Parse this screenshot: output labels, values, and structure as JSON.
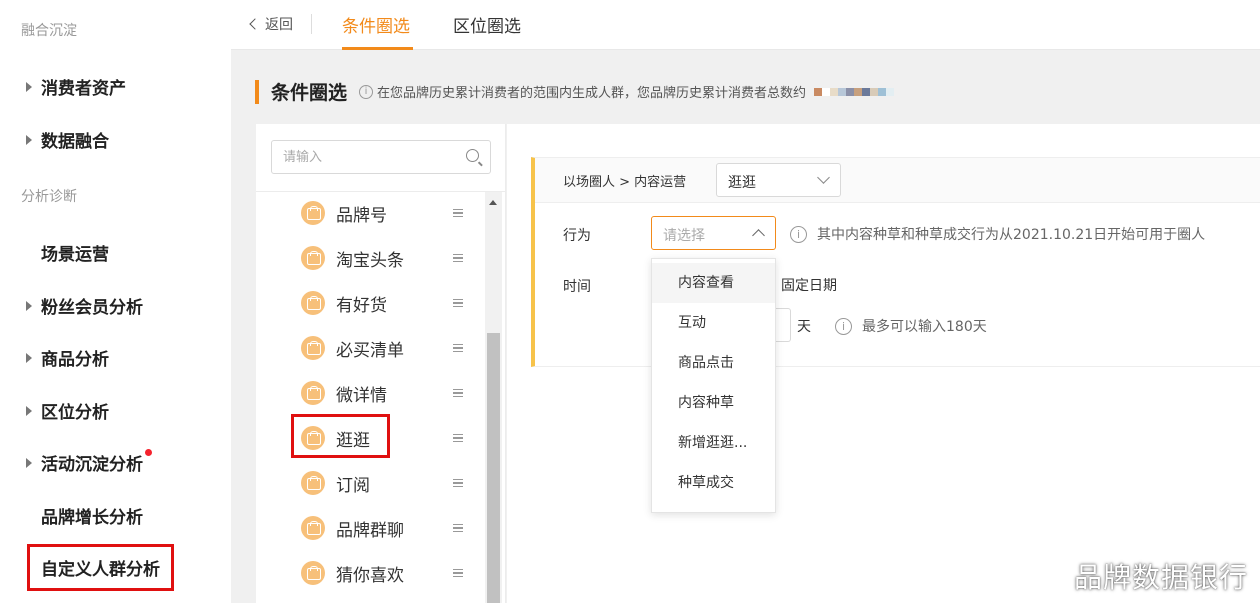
{
  "sidebar": {
    "sections": [
      "融合沉淀",
      "分析诊断"
    ],
    "items": [
      {
        "label": "消费者资产",
        "has_arrow": true
      },
      {
        "label": "数据融合",
        "has_arrow": true
      },
      {
        "label": "场景运营",
        "has_arrow": false
      },
      {
        "label": "粉丝会员分析",
        "has_arrow": true
      },
      {
        "label": "商品分析",
        "has_arrow": true
      },
      {
        "label": "区位分析",
        "has_arrow": true
      },
      {
        "label": "活动沉淀分析",
        "has_arrow": true,
        "badge": "red-dot"
      },
      {
        "label": "品牌增长分析",
        "has_arrow": false
      },
      {
        "label": "自定义人群分析",
        "has_arrow": false,
        "highlighted": true
      }
    ]
  },
  "topbar": {
    "back_label": "返回",
    "tabs": [
      {
        "label": "条件圈选",
        "active": true
      },
      {
        "label": "区位圈选",
        "active": false
      }
    ]
  },
  "header": {
    "title": "条件圈选",
    "description": "在您品牌历史累计消费者的范围内生成人群，您品牌历史累计消费者总数约"
  },
  "list": {
    "search_placeholder": "请输入",
    "items": [
      {
        "label": "品牌号",
        "icon": "shopping-bag-icon"
      },
      {
        "label": "淘宝头条",
        "icon": "shopping-bag-icon"
      },
      {
        "label": "有好货",
        "icon": "shopping-bag-icon"
      },
      {
        "label": "必买清单",
        "icon": "shopping-bag-icon"
      },
      {
        "label": "微详情",
        "icon": "shopping-bag-icon"
      },
      {
        "label": "逛逛",
        "icon": "shopping-bag-icon",
        "highlighted": true
      },
      {
        "label": "订阅",
        "icon": "shopping-bag-icon"
      },
      {
        "label": "品牌群聊",
        "icon": "shopping-bag-icon"
      },
      {
        "label": "猜你喜欢",
        "icon": "shopping-bag-icon"
      }
    ]
  },
  "form": {
    "breadcrumb": "以场圈人 > 内容运营",
    "scene_value": "逛逛",
    "behavior_label": "行为",
    "behavior_placeholder": "请选择",
    "behavior_hint": "其中内容种草和种草成交行为从2021.10.21日开始可用于圈人",
    "time_label": "时间",
    "fixed_date_label": "固定日期",
    "day_unit": "天",
    "day_hint": "最多可以输入180天",
    "dropdown_options": [
      "内容查看",
      "互动",
      "商品点击",
      "内容种草",
      "新增逛逛...",
      "种草成交"
    ],
    "hovered_option": "内容查看"
  },
  "watermark": "品牌数据银行",
  "colors": {
    "accent": "#f28a1a",
    "highlight_box": "#e01010",
    "card_border": "#f7c34a",
    "icon_bg": "#f7c07a"
  }
}
